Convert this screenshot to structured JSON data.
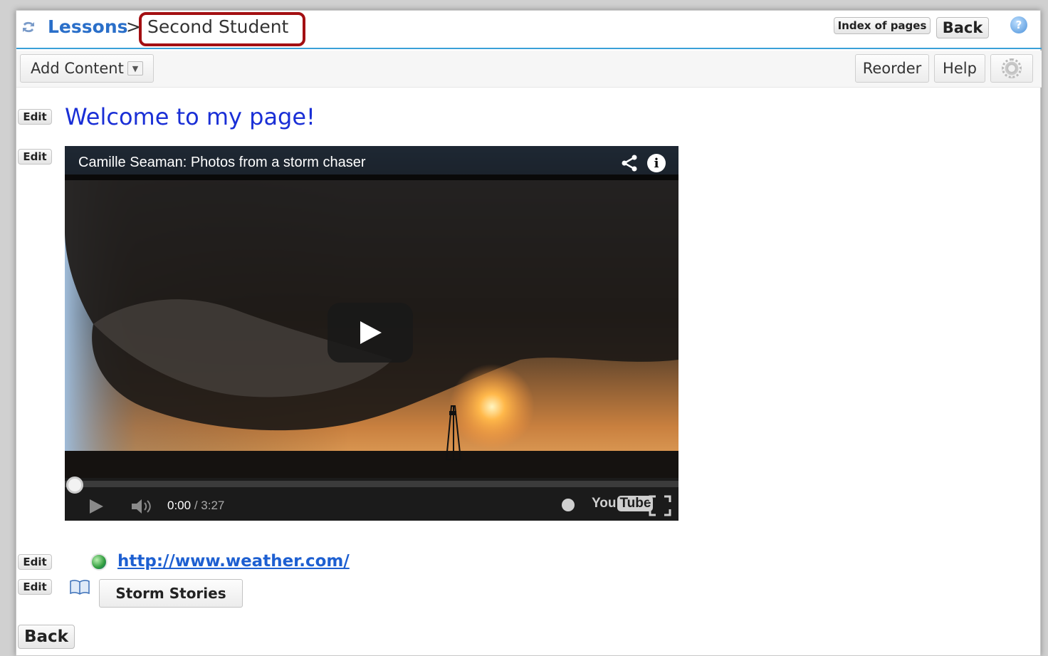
{
  "breadcrumb": {
    "root": "Lessons",
    "separator": ">",
    "current": "Second Student"
  },
  "header": {
    "index_label": "Index of pages",
    "back_label": "Back",
    "help_icon": "?"
  },
  "toolbar": {
    "add_content_label": "Add Content",
    "reorder_label": "Reorder",
    "help_label": "Help"
  },
  "content": {
    "edit_label": "Edit",
    "heading": "Welcome to my page!",
    "video": {
      "title": "Camille Seaman: Photos from a storm chaser",
      "current_time": "0:00",
      "separator": " / ",
      "duration": "3:27",
      "progress_fraction": 0,
      "brand_you": "You",
      "brand_tube": "Tube"
    },
    "link_text": "http://www.weather.com/",
    "book_button_label": "Storm Stories",
    "back_label": "Back"
  },
  "colors": {
    "accent_link": "#1d5fd1",
    "heading": "#1a2fd6",
    "header_rule": "#3aa0d8",
    "highlight": "#a30f12"
  }
}
